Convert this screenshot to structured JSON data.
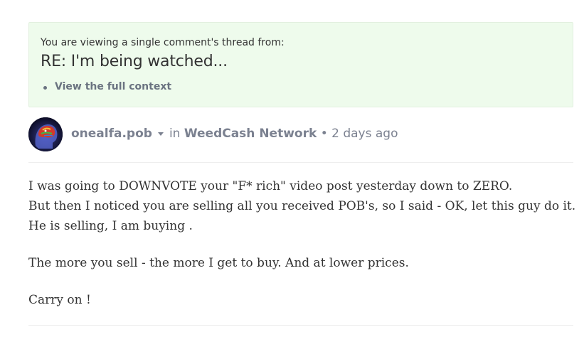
{
  "context": {
    "intro": "You are viewing a single comment's thread from:",
    "title": "RE: I'm being watched...",
    "links": [
      "View the full context"
    ]
  },
  "comment": {
    "author": "onealfa.pob",
    "in_label": "in",
    "community": "WeedCash Network",
    "separator": "•",
    "time": "2 days ago",
    "paragraphs": [
      [
        "I was going to DOWNVOTE your \"F* rich\" video post yesterday down to ZERO.",
        "But then I noticed you are selling all you received POB's, so I said - OK, let this guy do it.",
        "He is selling, I am buying ."
      ],
      [
        "The more you sell - the more I get to buy. And at lower prices."
      ],
      [
        "Carry on !"
      ]
    ]
  },
  "colors": {
    "context_bg": "#eefbec",
    "meta_text": "#7b8190",
    "body_text": "#333333"
  }
}
